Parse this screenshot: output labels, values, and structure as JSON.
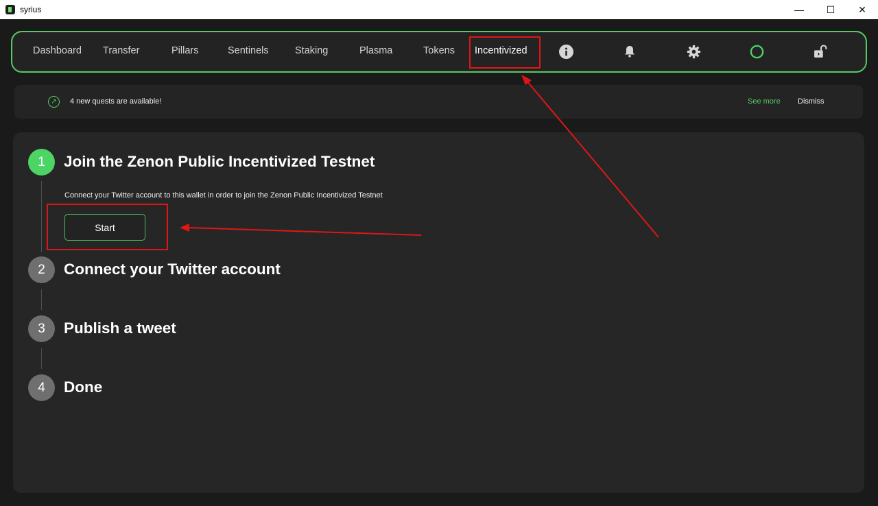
{
  "window": {
    "title": "syrius",
    "minimize": "—",
    "maximize": "☐",
    "close": "✕"
  },
  "nav": {
    "items": [
      {
        "label": "Dashboard"
      },
      {
        "label": "Transfer"
      },
      {
        "label": "Pillars"
      },
      {
        "label": "Sentinels"
      },
      {
        "label": "Staking"
      },
      {
        "label": "Plasma"
      },
      {
        "label": "Tokens"
      },
      {
        "label": "Incentivized",
        "active": true
      }
    ],
    "icons": [
      "info-icon",
      "bell-icon",
      "gear-icon",
      "status-circle-icon",
      "unlock-icon"
    ]
  },
  "notice": {
    "text": "4 new quests are available!",
    "see_more": "See more",
    "dismiss": "Dismiss"
  },
  "steps": [
    {
      "number": "1",
      "title": "Join the Zenon Public Incentivized Testnet",
      "state": "active",
      "description": "Connect your Twitter account to this wallet in order to join the Zenon Public Incentivized Testnet",
      "button": "Start"
    },
    {
      "number": "2",
      "title": "Connect your Twitter account",
      "state": "pending"
    },
    {
      "number": "3",
      "title": "Publish a tweet",
      "state": "pending"
    },
    {
      "number": "4",
      "title": "Done",
      "state": "pending"
    }
  ],
  "colors": {
    "accent": "#58c964",
    "highlight": "#e01616",
    "background": "#1a1a1a"
  }
}
